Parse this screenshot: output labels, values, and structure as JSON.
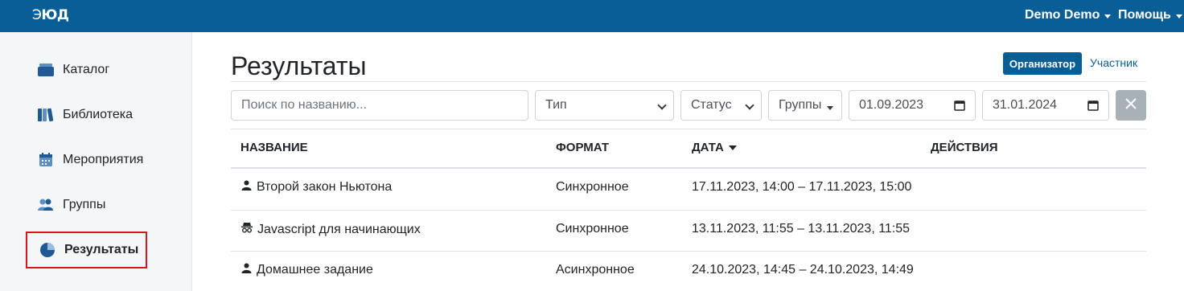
{
  "app": {
    "logo_text": "ЮД",
    "logo_prefix": "Э"
  },
  "topbar": {
    "user_menu": "Demo Demo",
    "help_menu": "Помощь"
  },
  "sidebar": {
    "items": [
      {
        "label": "Каталог",
        "icon": "catalog-icon"
      },
      {
        "label": "Библиотека",
        "icon": "library-icon"
      },
      {
        "label": "Мероприятия",
        "icon": "calendar-icon"
      },
      {
        "label": "Группы",
        "icon": "groups-icon"
      },
      {
        "label": "Результаты",
        "icon": "pie-chart-icon",
        "active": true
      }
    ]
  },
  "page": {
    "title": "Результаты",
    "roles": {
      "organizer": "Организатор",
      "participant": "Участник"
    }
  },
  "filters": {
    "search_placeholder": "Поиск по названию...",
    "type": "Тип",
    "status": "Статус",
    "groups": "Группы",
    "date_from": "01.09.2023",
    "date_to": "31.01.2024"
  },
  "table": {
    "headers": {
      "name": "Название",
      "format": "Формат",
      "date": "Дата",
      "actions": "Действия"
    },
    "rows": [
      {
        "icon": "user-icon",
        "name": "Второй закон Ньютона",
        "format": "Синхронное",
        "date": "17.11.2023, 14:00 – 17.11.2023, 15:00"
      },
      {
        "icon": "incognito-icon",
        "name": "Javascript для начинающих",
        "format": "Синхронное",
        "date": "13.11.2023, 11:55 – 13.11.2023, 11:55"
      },
      {
        "icon": "user-icon",
        "name": "Домашнее задание",
        "format": "Асинхронное",
        "date": "24.10.2023, 14:45 – 24.10.2023, 14:49"
      }
    ]
  },
  "colors": {
    "brand": "#0a5e96",
    "highlight": "#d9151e",
    "clear_button": "#a9b1b8"
  }
}
